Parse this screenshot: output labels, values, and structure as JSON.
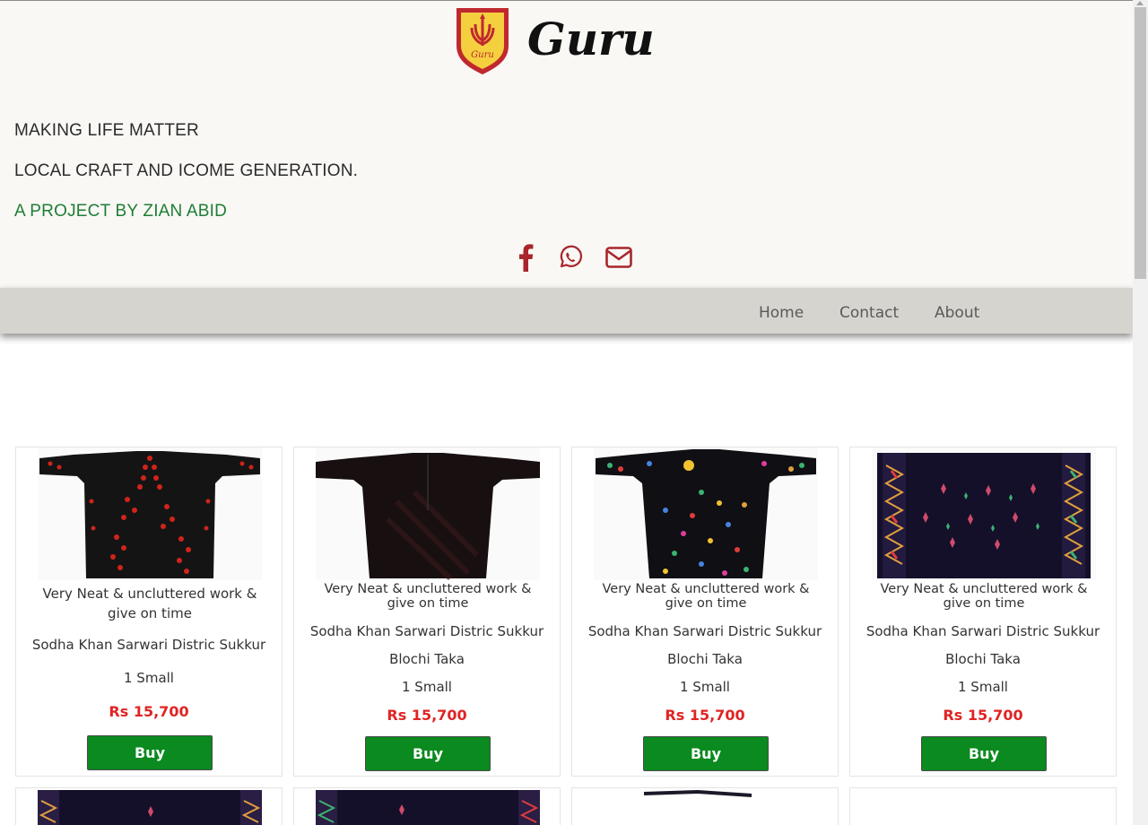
{
  "brand": {
    "name": "Guru",
    "shield_text": "Guru",
    "brand_color": "#c0282f",
    "shield_fill": "#f4d03f"
  },
  "header": {
    "taglines": [
      "MAKING LIFE MATTER",
      "LOCAL CRAFT AND ICOME GENERATION.",
      "A PROJECT BY ZIAN ABID"
    ],
    "social_icons": [
      "facebook-icon",
      "whatsapp-icon",
      "mail-icon"
    ],
    "icon_color": "#a8262b"
  },
  "nav": {
    "items": [
      "Home",
      "Contact",
      "About"
    ]
  },
  "products": [
    {
      "image": "black-kurta-red-embroidery",
      "description": "Very Neat & uncluttered work & give on time",
      "seller": "Sodha Khan Sarwari Distric Sukkur",
      "name": "",
      "size": "1 Small",
      "price": "Rs 15,700",
      "buy_label": "Buy"
    },
    {
      "image": "black-plain-kurta",
      "description": "Very Neat & uncluttered work & give on time",
      "seller": "Sodha Khan Sarwari Distric Sukkur",
      "name": "Blochi Taka",
      "size": "1 Small",
      "price": "Rs 15,700",
      "buy_label": "Buy"
    },
    {
      "image": "black-kurta-multicolor-flowers",
      "description": "Very Neat & uncluttered work & give on time",
      "seller": "Sodha Khan Sarwari Distric Sukkur",
      "name": "Blochi Taka",
      "size": "1 Small",
      "price": "Rs 15,700",
      "buy_label": "Buy"
    },
    {
      "image": "black-shawl-embroidered-border",
      "description": "Very Neat & uncluttered work & give on time",
      "seller": "Sodha Khan Sarwari Distric Sukkur",
      "name": "Blochi Taka",
      "size": "1 Small",
      "price": "Rs 15,700",
      "buy_label": "Buy"
    }
  ],
  "colors": {
    "header_bg": "#f9f8f5",
    "nav_bg": "#d5d4cf",
    "price": "#e02424",
    "buy_button": "#0a8a1f",
    "tagline_green": "#1e7e34"
  }
}
